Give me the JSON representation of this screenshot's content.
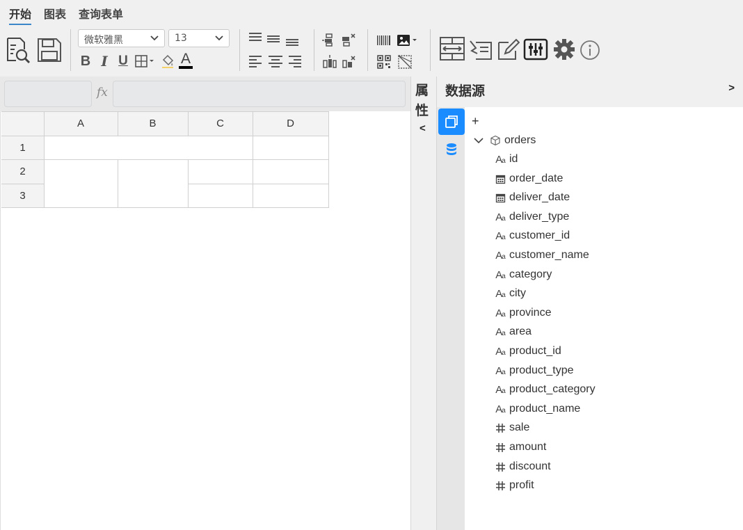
{
  "menu": {
    "tabs": [
      {
        "label": "开始",
        "active": true
      },
      {
        "label": "图表",
        "active": false
      },
      {
        "label": "查询表单",
        "active": false
      }
    ]
  },
  "toolbar": {
    "font_family": "微软雅黑",
    "font_size": "13",
    "bold_label": "B",
    "italic_label": "I",
    "underline_label": "U",
    "font_color_label": "A",
    "accent_color": "#1a8cff",
    "font_color_underline": "#000000"
  },
  "formula_bar": {
    "cell_name": "",
    "fx_label": "fx",
    "formula": ""
  },
  "sheet": {
    "columns": [
      "A",
      "B",
      "C",
      "D"
    ],
    "rows": [
      "1",
      "2",
      "3"
    ]
  },
  "properties_panel": {
    "title": "属性",
    "collapse_label": "<"
  },
  "data_source": {
    "title": "数据源",
    "expand_label": ">",
    "add_label": "+",
    "dataset": "orders",
    "fields": [
      {
        "name": "id",
        "type": "text"
      },
      {
        "name": "order_date",
        "type": "date"
      },
      {
        "name": "deliver_date",
        "type": "date"
      },
      {
        "name": "deliver_type",
        "type": "text"
      },
      {
        "name": "customer_id",
        "type": "text"
      },
      {
        "name": "customer_name",
        "type": "text"
      },
      {
        "name": "category",
        "type": "text"
      },
      {
        "name": "city",
        "type": "text"
      },
      {
        "name": "province",
        "type": "text"
      },
      {
        "name": "area",
        "type": "text"
      },
      {
        "name": "product_id",
        "type": "text"
      },
      {
        "name": "product_type",
        "type": "text"
      },
      {
        "name": "product_category",
        "type": "text"
      },
      {
        "name": "product_name",
        "type": "text"
      },
      {
        "name": "sale",
        "type": "number"
      },
      {
        "name": "amount",
        "type": "number"
      },
      {
        "name": "discount",
        "type": "number"
      },
      {
        "name": "profit",
        "type": "number"
      }
    ]
  }
}
